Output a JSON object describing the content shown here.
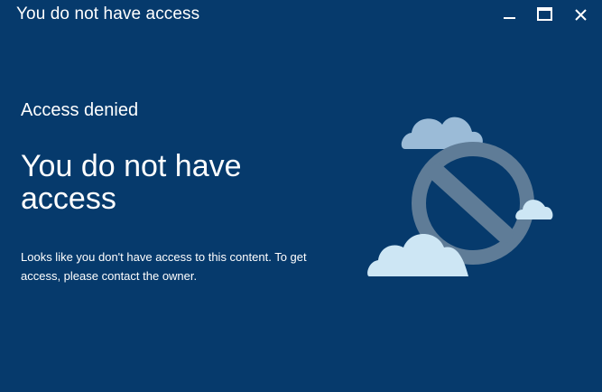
{
  "window": {
    "title": "You do not have access"
  },
  "main": {
    "eyebrow": "Access denied",
    "headline": "You do not have access",
    "description": "Looks like you don't have access to this content. To get access, please contact the owner."
  },
  "icons": {
    "minimize": "minimize-icon",
    "maximize": "maximize-icon",
    "close": "close-icon",
    "illustration": "prohibited-sign-with-clouds"
  },
  "colors": {
    "background": "#063a6c",
    "text": "#ffffff",
    "cloud": "#c8e4f3",
    "prohibited_sign": "#5f7c97"
  }
}
